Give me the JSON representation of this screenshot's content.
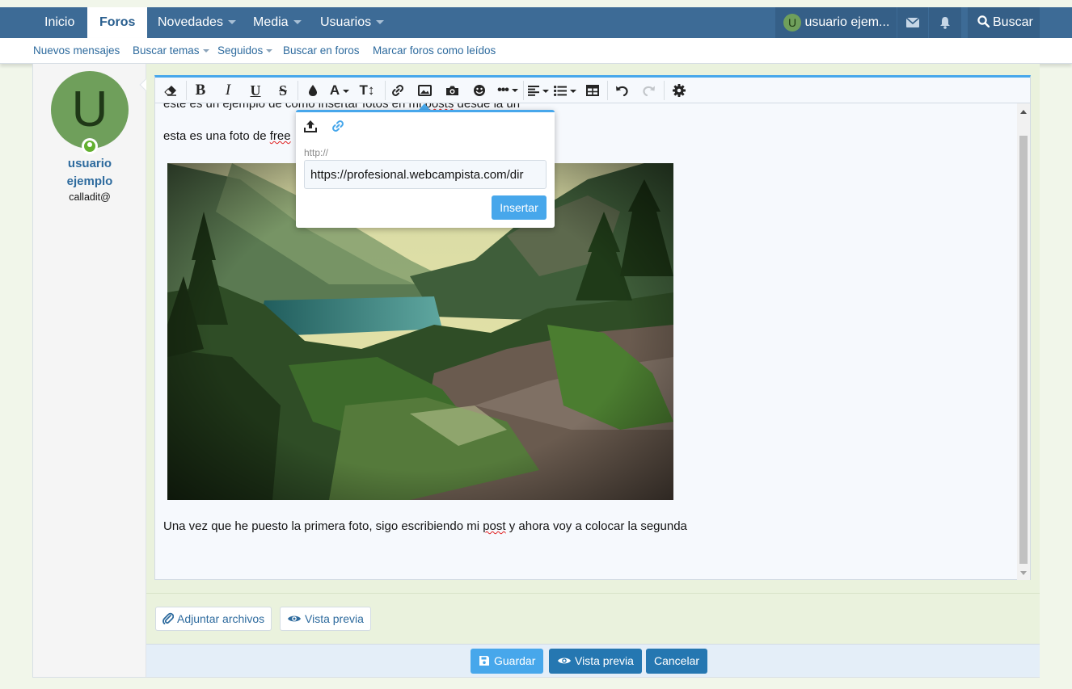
{
  "nav": {
    "tabs": [
      {
        "label": "Inicio"
      },
      {
        "label": "Foros"
      },
      {
        "label": "Novedades"
      },
      {
        "label": "Media"
      },
      {
        "label": "Usuarios"
      }
    ],
    "user_avatar_letter": "U",
    "user_label": "usuario ejem...",
    "search_label": "Buscar"
  },
  "subnav": {
    "items": [
      {
        "label": "Nuevos mensajes"
      },
      {
        "label": "Buscar temas"
      },
      {
        "label": "Seguidos"
      },
      {
        "label": "Buscar en foros"
      },
      {
        "label": "Marcar foros como leídos"
      }
    ]
  },
  "user": {
    "avatar_letter": "U",
    "name_line1": "usuario",
    "name_line2": "ejemplo",
    "title": "calladit@"
  },
  "editor": {
    "line1_prefix": "este es un ejemplo de como insertar fotos en mi ",
    "line1_squiggle": "posts",
    "line1_suffix": " desde la url",
    "line2_prefix": "esta es una foto de ",
    "line2_squiggle": "free",
    "line3_prefix": "Una vez que he puesto la primera foto, sigo escribiendo mi ",
    "line3_squiggle": "post",
    "line3_suffix": " y ahora voy a colocar la segunda"
  },
  "popup": {
    "label": "http://",
    "input_value": "https://profesional.webcampista.com/dir",
    "insert_button": "Insertar"
  },
  "actions": {
    "attach_label": "Adjuntar archivos",
    "preview_label": "Vista previa",
    "save_label": "Guardar",
    "preview2_label": "Vista previa",
    "cancel_label": "Cancelar"
  },
  "colors": {
    "nav_bg": "#3d6b96",
    "accent": "#47a7eb",
    "primary_btn": "#2577b1",
    "avatar_bg": "#6f9f5b",
    "online": "#63b030"
  }
}
